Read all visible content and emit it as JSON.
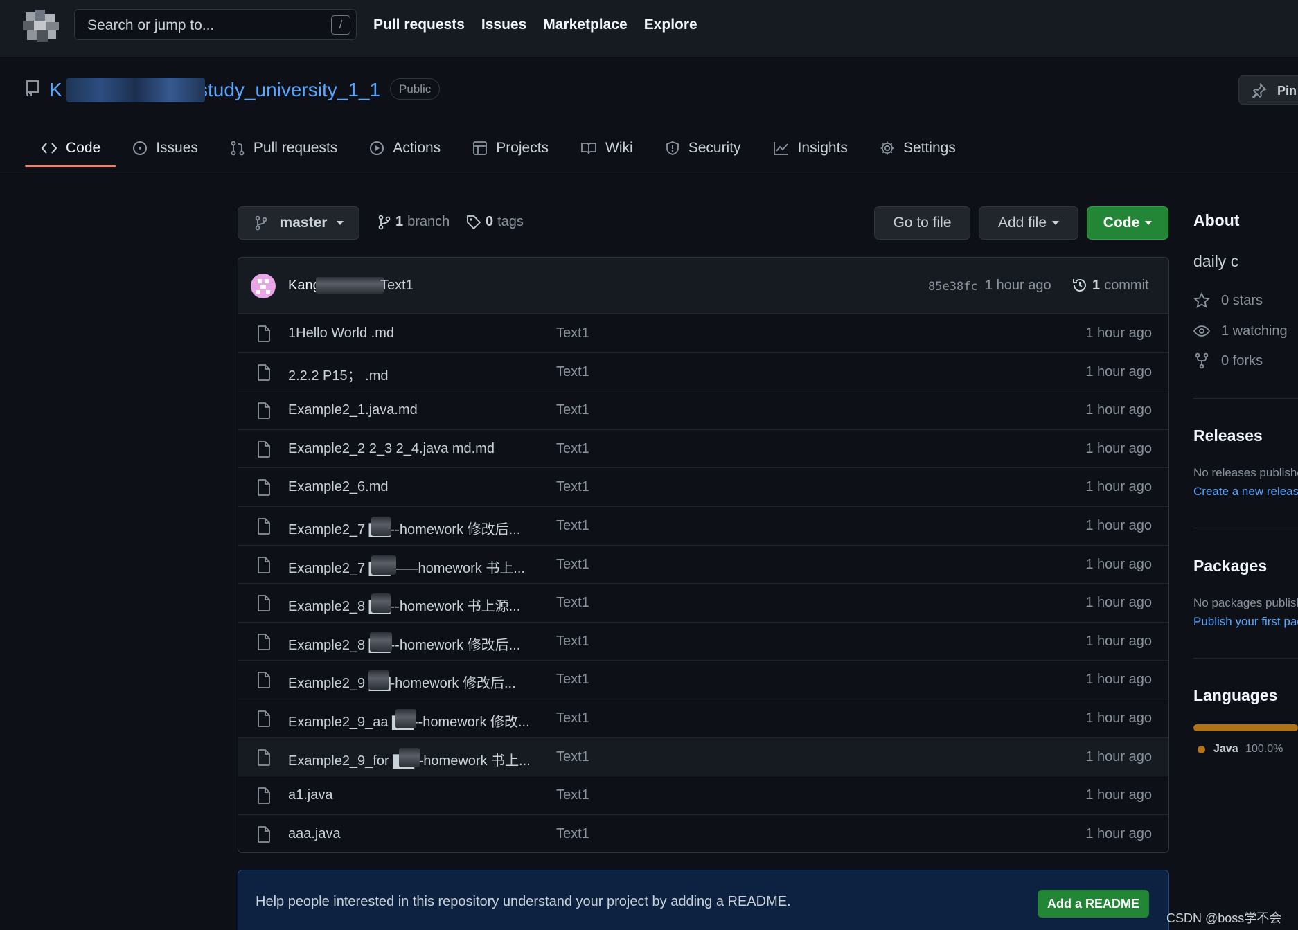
{
  "header": {
    "search_placeholder": "Search or jump to...",
    "search_shortcut": "/",
    "nav": [
      "Pull requests",
      "Issues",
      "Marketplace",
      "Explore"
    ]
  },
  "repo": {
    "name": "K... study_university_1_1",
    "name_suffix": "study_university_1_1",
    "visibility": "Public",
    "pin_label": "Pin"
  },
  "tabs": [
    {
      "label": "Code",
      "icon": "code-icon"
    },
    {
      "label": "Issues",
      "icon": "issue-icon"
    },
    {
      "label": "Pull requests",
      "icon": "pull-request-icon"
    },
    {
      "label": "Actions",
      "icon": "play-icon"
    },
    {
      "label": "Projects",
      "icon": "table-icon"
    },
    {
      "label": "Wiki",
      "icon": "book-icon"
    },
    {
      "label": "Security",
      "icon": "shield-icon"
    },
    {
      "label": "Insights",
      "icon": "graph-icon"
    },
    {
      "label": "Settings",
      "icon": "gear-icon"
    }
  ],
  "branch_bar": {
    "branch": "master",
    "branch_count": "1",
    "branch_word": "branch",
    "tag_count": "0",
    "tag_word": "tags",
    "go_to_file": "Go to file",
    "add_file": "Add file",
    "code": "Code"
  },
  "commit": {
    "author": "Kang",
    "message": "Text1",
    "sha": "85e38fc",
    "time": "1 hour ago",
    "count": "1",
    "count_word": "commit"
  },
  "files": [
    {
      "name": "1Hello World .md",
      "message": "Text1",
      "time": "1 hour ago"
    },
    {
      "name": "2.2.2 P15； .md",
      "message": "Text1",
      "time": "1 hour ago"
    },
    {
      "name": "Example2_1.java.md",
      "message": "Text1",
      "time": "1 hour ago"
    },
    {
      "name": "Example2_2 2_3 2_4.java md.md",
      "message": "Text1",
      "time": "1 hour ago"
    },
    {
      "name": "Example2_6.md",
      "message": "Text1",
      "time": "1 hour ago"
    },
    {
      "name": "Example2_7 ▇▇--homework 修改后...",
      "message": "Text1",
      "time": "1 hour ago"
    },
    {
      "name": "Example2_7 ▇▇——homework 书上...",
      "message": "Text1",
      "time": "1 hour ago"
    },
    {
      "name": "Example2_8 ▇▇--homework 书上源...",
      "message": "Text1",
      "time": "1 hour ago"
    },
    {
      "name": "Example2_8 ▇▇--homework 修改后...",
      "message": "Text1",
      "time": "1 hour ago"
    },
    {
      "name": "Example2_9 ▇▇-homework 修改后...",
      "message": "Text1",
      "time": "1 hour ago"
    },
    {
      "name": "Example2_9_aa ▇▇--homework 修改...",
      "message": "Text1",
      "time": "1 hour ago"
    },
    {
      "name": "Example2_9_for ▇▇--homework 书上...",
      "message": "Text1",
      "time": "1 hour ago"
    },
    {
      "name": "a1.java",
      "message": "Text1",
      "time": "1 hour ago"
    },
    {
      "name": "aaa.java",
      "message": "Text1",
      "time": "1 hour ago"
    }
  ],
  "readme_banner": {
    "text": "Help people interested in this repository understand your project by adding a README.",
    "button": "Add a README"
  },
  "sidebar": {
    "about_heading": "About",
    "description": "daily c",
    "stars": "0 stars",
    "watching": "1 watching",
    "forks": "0 forks",
    "releases_heading": "Releases",
    "releases_text": "No releases published",
    "releases_link": "Create a new release",
    "packages_heading": "Packages",
    "packages_text": "No packages published",
    "packages_link": "Publish your first package",
    "languages_heading": "Languages",
    "language_name": "Java",
    "language_percent": "100.0%",
    "language_color": "#b07219"
  },
  "watermark": "CSDN @boss学不会"
}
